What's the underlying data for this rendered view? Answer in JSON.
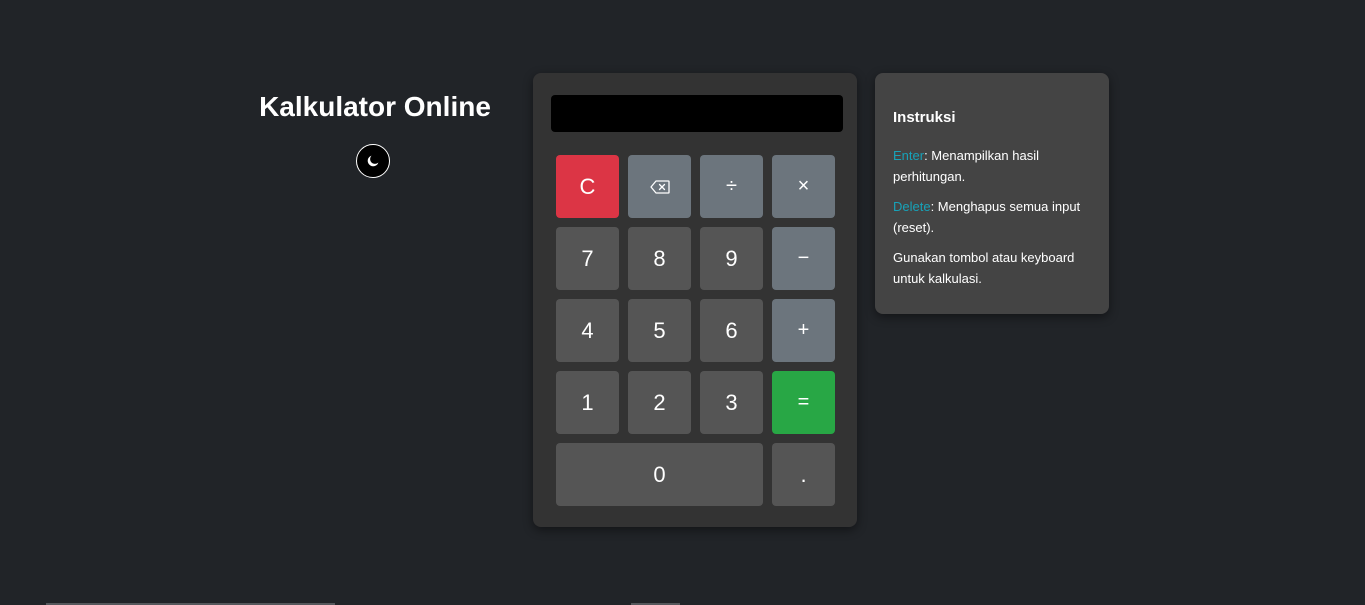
{
  "header": {
    "title": "Kalkulator Online",
    "theme_toggle_icon": "moon-icon"
  },
  "calculator": {
    "display_value": "",
    "keys": {
      "clear": "C",
      "backspace_icon": "backspace-icon",
      "divide": "÷",
      "multiply": "×",
      "seven": "7",
      "eight": "8",
      "nine": "9",
      "minus": "−",
      "four": "4",
      "five": "5",
      "six": "6",
      "plus": "+",
      "one": "1",
      "two": "2",
      "three": "3",
      "equals": "=",
      "zero": "0",
      "decimal": "."
    }
  },
  "instructions": {
    "title": "Instruksi",
    "enter_key": "Enter",
    "enter_text": ": Menampilkan hasil perhitungan.",
    "delete_key": "Delete",
    "delete_text": ": Menghapus semua input (reset).",
    "general_text": "Gunakan tombol atau keyboard untuk kalkulasi."
  },
  "colors": {
    "background": "#212428",
    "calculator_bg": "#333333",
    "number_key": "#555555",
    "operator_key": "#6c757d",
    "clear_key": "#dc3545",
    "equals_key": "#28a745",
    "instructions_bg": "#444444",
    "key_highlight": "#17a2b8"
  }
}
